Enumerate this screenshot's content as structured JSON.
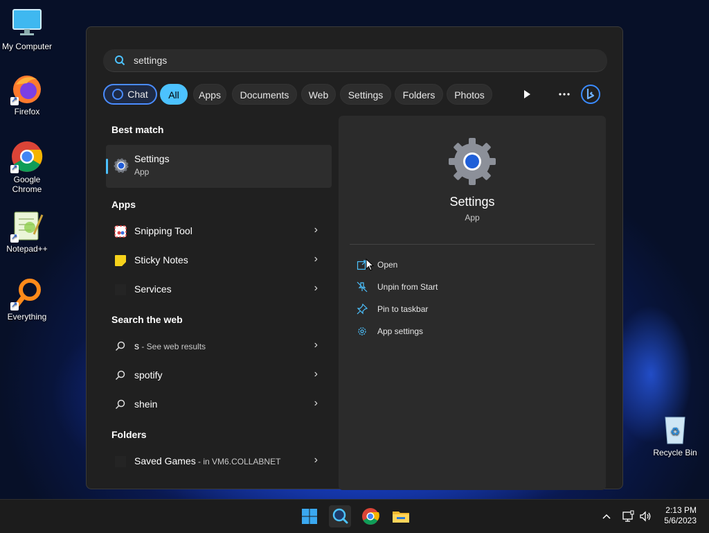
{
  "desktop": {
    "icons": [
      {
        "label": "My Computer"
      },
      {
        "label": "Firefox"
      },
      {
        "label": "Google Chrome"
      },
      {
        "label": "Notepad++"
      },
      {
        "label": "Everything"
      },
      {
        "label": "Recycle Bin"
      }
    ]
  },
  "search": {
    "query": "settings",
    "filters": [
      "Chat",
      "All",
      "Apps",
      "Documents",
      "Web",
      "Settings",
      "Folders",
      "Photos"
    ],
    "active_filter": "All"
  },
  "results": {
    "best_match_header": "Best match",
    "best_match": {
      "title": "Settings",
      "subtitle": "App"
    },
    "apps_header": "Apps",
    "apps": [
      {
        "label": "Snipping Tool"
      },
      {
        "label": "Sticky Notes"
      },
      {
        "label": "Services"
      }
    ],
    "web_header": "Search the web",
    "web": [
      {
        "label": "s",
        "suffix": " - See web results"
      },
      {
        "label": "spotify"
      },
      {
        "label": "shein"
      }
    ],
    "folders_header": "Folders",
    "folders": [
      {
        "label": "Saved Games",
        "suffix": " - in VM6.COLLABNET"
      }
    ]
  },
  "details": {
    "title": "Settings",
    "subtitle": "App",
    "actions": [
      {
        "label": "Open",
        "icon": "open-icon"
      },
      {
        "label": "Unpin from Start",
        "icon": "unpin-icon"
      },
      {
        "label": "Pin to taskbar",
        "icon": "pin-icon"
      },
      {
        "label": "App settings",
        "icon": "gear-icon"
      }
    ]
  },
  "taskbar": {
    "time": "2:13 PM",
    "date": "5/6/2023"
  },
  "colors": {
    "accent": "#4cc2ff",
    "panel": "#202020",
    "pane": "#2b2b2b",
    "taskbar": "#1c1c1c"
  }
}
